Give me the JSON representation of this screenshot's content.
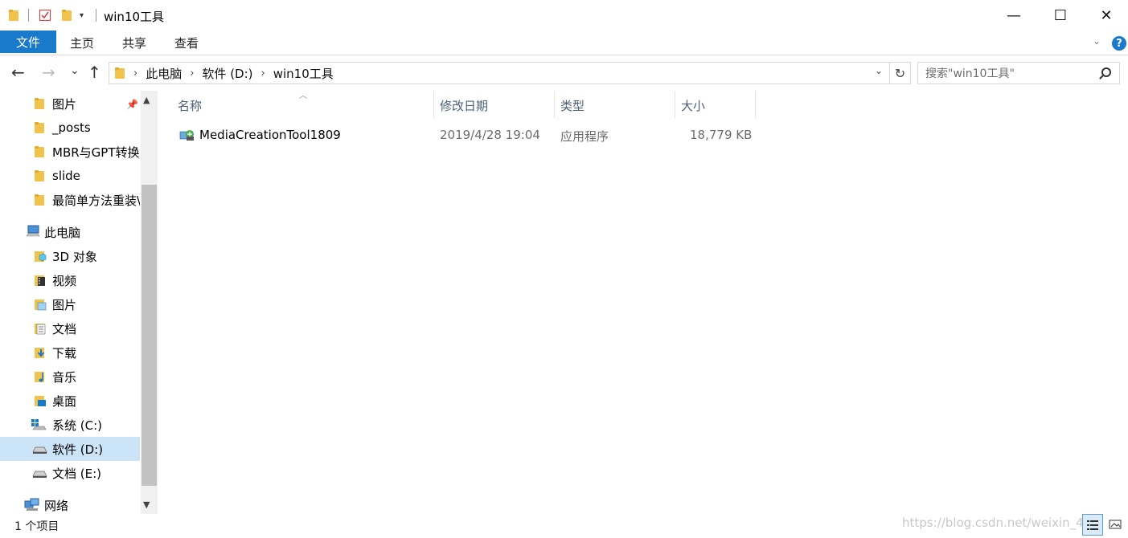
{
  "window": {
    "title": "win10工具",
    "minimize": "—",
    "maximize": "☐",
    "close": "✕"
  },
  "ribbon": {
    "file_tab": "文件",
    "tabs": [
      "主页",
      "共享",
      "查看"
    ],
    "help": "?"
  },
  "navigation": {
    "back": "←",
    "forward": "→",
    "recent": "⌄",
    "up": "↑",
    "breadcrumb": [
      "此电脑",
      "软件 (D:)",
      "win10工具"
    ],
    "search_placeholder": "搜索\"win10工具\""
  },
  "sidebar": {
    "quick_access": [
      "图片",
      "_posts",
      "MBR与GPT转换",
      "slide",
      "最简单方法重装\\"
    ],
    "this_pc": "此电脑",
    "pc_items": [
      "3D 对象",
      "视频",
      "图片",
      "文档",
      "下载",
      "音乐",
      "桌面",
      "系统 (C:)",
      "软件 (D:)",
      "文档 (E:)"
    ],
    "network": "网络",
    "selected": "软件 (D:)"
  },
  "columns": [
    "名称",
    "修改日期",
    "类型",
    "大小"
  ],
  "files": [
    {
      "name": "MediaCreationTool1809",
      "date": "2019/4/28 19:04",
      "type": "应用程序",
      "size": "18,779 KB"
    }
  ],
  "status": {
    "count": "1 个项目",
    "watermark": "https://blog.csdn.net/weixin_42"
  },
  "colors": {
    "accent": "#1979ca",
    "selected_bg": "#cce4f7",
    "header_text": "#4c607a"
  }
}
